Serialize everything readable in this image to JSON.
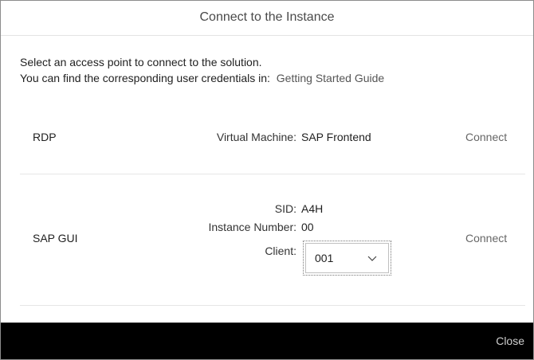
{
  "dialog": {
    "title": "Connect to the Instance",
    "intro_line1": "Select an access point to connect to the solution.",
    "intro_line2": "You can find the corresponding user credentials in:",
    "guide_link": "Getting Started Guide"
  },
  "rdp": {
    "label": "RDP",
    "vm_label": "Virtual Machine:",
    "vm_value": "SAP Frontend",
    "connect_label": "Connect"
  },
  "sapgui": {
    "label": "SAP GUI",
    "sid_label": "SID:",
    "sid_value": "A4H",
    "instance_label": "Instance Number:",
    "instance_value": "00",
    "client_label": "Client:",
    "client_value": "001",
    "connect_label": "Connect"
  },
  "footer": {
    "close_label": "Close"
  }
}
